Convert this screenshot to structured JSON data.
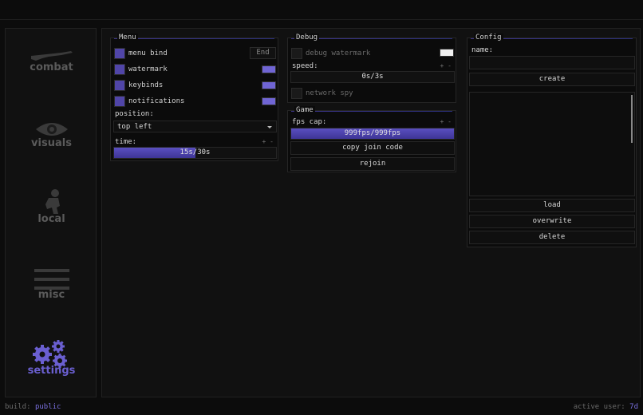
{
  "sidebar": {
    "tabs": [
      {
        "label": "combat",
        "icon": "rifle-icon"
      },
      {
        "label": "visuals",
        "icon": "eye-icon"
      },
      {
        "label": "local",
        "icon": "player-icon"
      },
      {
        "label": "misc",
        "icon": "lines-icon"
      },
      {
        "label": "settings",
        "icon": "gears-icon",
        "active": true
      }
    ]
  },
  "menu_panel": {
    "title": "Menu",
    "menu_bind_label": "menu bind",
    "menu_bind_key": "End",
    "watermark_label": "watermark",
    "keybinds_label": "keybinds",
    "notifications_label": "notifications",
    "position_label": "position:",
    "position_value": "top left",
    "time_label": "time:",
    "time_value": "15s/30s",
    "time_fraction": 0.5,
    "plus_minus": "+ -"
  },
  "debug_panel": {
    "title": "Debug",
    "debug_watermark_label": "debug watermark",
    "speed_label": "speed:",
    "speed_value": "0s/3s",
    "speed_fraction": 0.0,
    "network_spy_label": "network spy",
    "plus_minus": "+ -"
  },
  "game_panel": {
    "title": "Game",
    "fps_cap_label": "fps cap:",
    "fps_cap_value": "999fps/999fps",
    "fps_fraction": 1.0,
    "copy_join_code_label": "copy join code",
    "rejoin_label": "rejoin",
    "plus_minus": "+ -"
  },
  "config_panel": {
    "title": "Config",
    "name_label": "name:",
    "name_value": "",
    "create_label": "create",
    "load_label": "load",
    "overwrite_label": "overwrite",
    "delete_label": "delete"
  },
  "footer": {
    "build_label": "build:",
    "build_value": "public",
    "active_user_label": "active user:",
    "active_user_value": "7d"
  },
  "colors": {
    "accent": "#6a5fd0",
    "checkbox_on": "#5045a8",
    "swatch_purple": "#7065d4"
  }
}
